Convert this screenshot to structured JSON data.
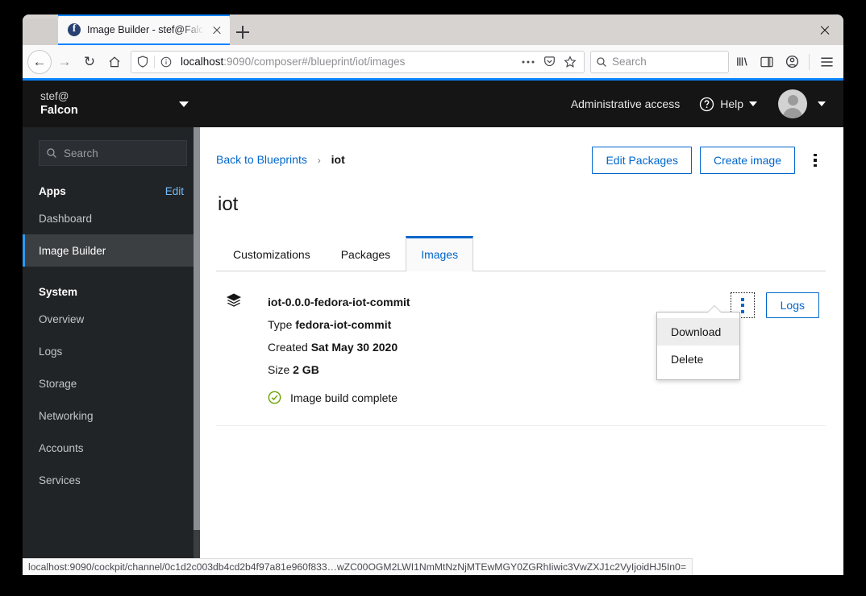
{
  "browser": {
    "tab": {
      "title": "Image Builder - stef@Falcon",
      "favicon": "firefox-favicon"
    },
    "new_tab_tooltip": "New Tab",
    "window_close": "×",
    "urlbar": {
      "host": "localhost",
      "path": ":9090/composer#/blueprint/iot/images",
      "full": "localhost:9090/composer#/blueprint/iot/images"
    },
    "search": {
      "placeholder": "Search"
    },
    "status_bar": "localhost:9090/cockpit/channel/0c1d2c003db4cd2b4f97a81e960f833…wZC00OGM2LWI1NmMtNzNjMTEwMGY0ZGRhIiwic3VwZXJ1c2VyIjoidHJ5In0="
  },
  "cockpit": {
    "host": {
      "user": "stef@",
      "machine": "Falcon"
    },
    "sidebar": {
      "search_placeholder": "Search",
      "sections": [
        {
          "title": "Apps",
          "action": "Edit",
          "items": [
            {
              "label": "Dashboard",
              "active": false
            },
            {
              "label": "Image Builder",
              "active": true
            }
          ]
        },
        {
          "title": "System",
          "action": "",
          "items": [
            {
              "label": "Overview",
              "active": false
            },
            {
              "label": "Logs",
              "active": false
            },
            {
              "label": "Storage",
              "active": false
            },
            {
              "label": "Networking",
              "active": false
            },
            {
              "label": "Accounts",
              "active": false
            },
            {
              "label": "Services",
              "active": false
            }
          ]
        }
      ]
    },
    "topbar": {
      "admin_access": "Administrative access",
      "help_label": "Help"
    },
    "breadcrumb": {
      "link": "Back to Blueprints",
      "separator": "›",
      "current": "iot"
    },
    "header_actions": {
      "edit_packages": "Edit Packages",
      "create_image": "Create image"
    },
    "page_title": "iot",
    "tabs": [
      {
        "label": "Customizations",
        "active": false
      },
      {
        "label": "Packages",
        "active": false
      },
      {
        "label": "Images",
        "active": true
      }
    ],
    "image": {
      "name": "iot-0.0.0-fedora-iot-commit",
      "type_label": "Type",
      "type_value": "fedora-iot-commit",
      "created_label": "Created",
      "created_value": "Sat May 30 2020",
      "size_label": "Size",
      "size_value": "2 GB",
      "status": "Image build complete",
      "logs_button": "Logs"
    },
    "dropdown": {
      "items": [
        {
          "label": "Download",
          "hovered": true
        },
        {
          "label": "Delete",
          "hovered": false
        }
      ]
    },
    "colors": {
      "accent_blue": "#0066cc",
      "sidebar_bg": "#212427",
      "topbar_bg": "#151515",
      "status_green": "#6ca100",
      "active_border": "#2b9af3"
    }
  }
}
